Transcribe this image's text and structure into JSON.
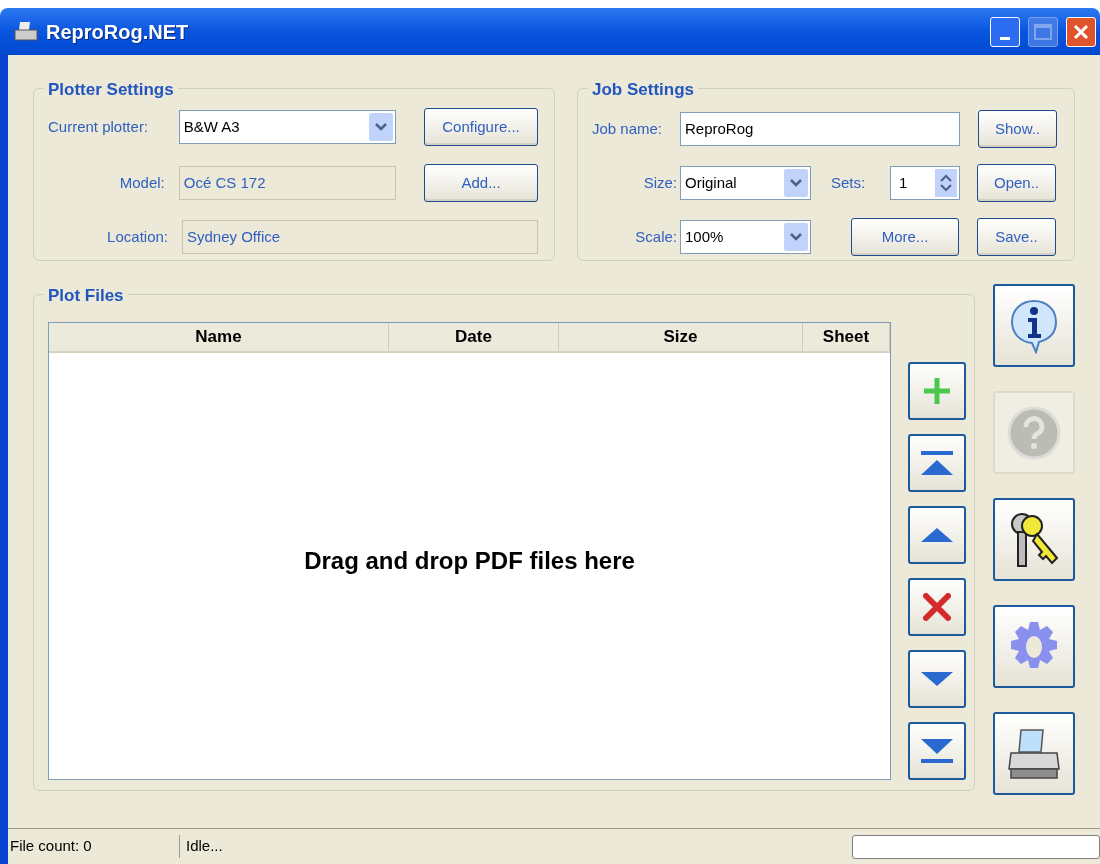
{
  "window": {
    "title": "ReproRog.NET"
  },
  "plotter_settings": {
    "title": "Plotter Settings",
    "current_plotter": {
      "label": "Current plotter:",
      "value": "B&W A3"
    },
    "model": {
      "label": "Model:",
      "value": "Océ CS 172",
      "disabled": true
    },
    "location": {
      "label": "Location:",
      "value": "Sydney Office",
      "disabled": true
    },
    "buttons": [
      "Configure...",
      "Add..."
    ]
  },
  "job_settings": {
    "title": "Job Settings",
    "job_name": {
      "label": "Job name:",
      "value": "ReproRog"
    },
    "size": {
      "label": "Size:",
      "value": "Original"
    },
    "sets": {
      "label": "Sets:",
      "value": "1"
    },
    "scale": {
      "label": "Scale:",
      "value": "100%"
    },
    "more_button": "More...",
    "side_buttons": [
      "Show..",
      "Open..",
      "Save.."
    ]
  },
  "plot_files": {
    "title": "Plot Files",
    "columns": [
      "Name",
      "Date",
      "Size",
      "Sheet"
    ],
    "empty_message": "Drag and drop PDF files here",
    "tools": [
      {
        "kind": "add"
      },
      {
        "kind": "top"
      },
      {
        "kind": "up"
      },
      {
        "kind": "delete"
      },
      {
        "kind": "down"
      },
      {
        "kind": "bottom"
      }
    ]
  },
  "side_buttons": [
    {
      "kind": "info",
      "disabled": false
    },
    {
      "kind": "help",
      "disabled": true
    },
    {
      "kind": "keys",
      "disabled": false
    },
    {
      "kind": "settings",
      "disabled": false
    },
    {
      "kind": "print",
      "disabled": false
    }
  ],
  "status_bar": {
    "file_count": "File count: 0",
    "status": "Idle...",
    "progress": {
      "level": 0
    }
  }
}
